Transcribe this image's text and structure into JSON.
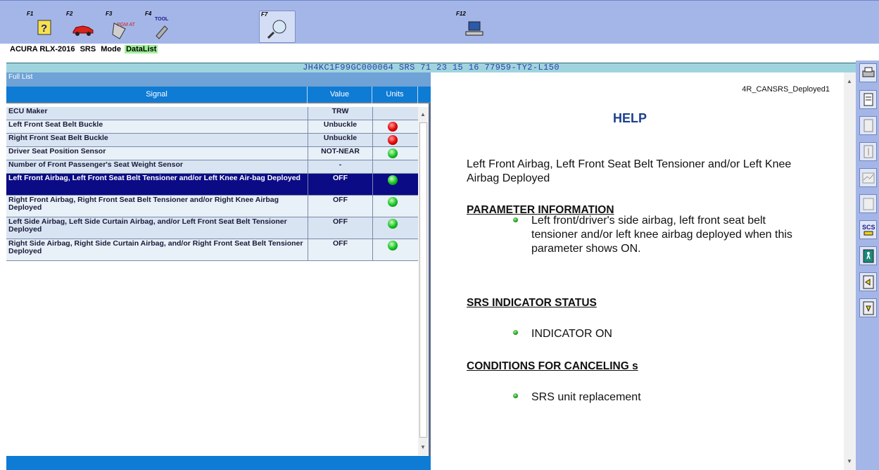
{
  "toolbar": {
    "keys": [
      {
        "label": "F1",
        "icon": "help-icon"
      },
      {
        "label": "F2",
        "icon": "car-icon"
      },
      {
        "label": "F3",
        "icon": "pgm-at-icon"
      },
      {
        "label": "F4",
        "icon": "tool-icon"
      },
      {
        "label": "F7",
        "icon": "search-globe-icon"
      },
      {
        "label": "F12",
        "icon": "computer-icon"
      }
    ],
    "tool_text": "TOOL",
    "pgm_text": "PGM AT"
  },
  "breadcrumb": {
    "vehicle": "ACURA RLX-2016",
    "system": "SRS",
    "mode_label": "Mode",
    "mode_value": "DataList"
  },
  "vin_bar": "JH4KC1F99GC000064  SRS  71 23 15 16  77959-TY2-L150",
  "list": {
    "title": "Full List",
    "headers": {
      "signal": "Signal",
      "value": "Value",
      "units": "Units"
    },
    "rows": [
      {
        "signal": "ECU Maker",
        "value": "TRW",
        "status": ""
      },
      {
        "signal": "Left Front Seat Belt Buckle",
        "value": "Unbuckle",
        "status": "red"
      },
      {
        "signal": "Right Front Seat Belt Buckle",
        "value": "Unbuckle",
        "status": "red"
      },
      {
        "signal": "Driver Seat Position Sensor",
        "value": "NOT-NEAR",
        "status": "green"
      },
      {
        "signal": "Number of Front Passenger's Seat Weight Sensor",
        "value": "-",
        "status": ""
      },
      {
        "signal": "Left Front Airbag, Left Front Seat Belt Tensioner and/or Left Knee Air-bag Deployed",
        "value": "OFF",
        "status": "green"
      },
      {
        "signal": "Right Front Airbag, Right Front Seat Belt Tensioner and/or Right Knee Airbag Deployed",
        "value": "OFF",
        "status": "green"
      },
      {
        "signal": "Left Side Airbag, Left Side Curtain Airbag, and/or Left Front Seat Belt Tensioner Deployed",
        "value": "OFF",
        "status": "green"
      },
      {
        "signal": "Right Side Airbag, Right Side Curtain Airbag, and/or Right Front Seat Belt Tensioner Deployed",
        "value": "OFF",
        "status": "green"
      }
    ],
    "selected_row": 5
  },
  "help": {
    "doc_id": "4R_CANSRS_Deployed1",
    "title": "HELP",
    "subject": "Left Front Airbag, Left Front Seat Belt Tensioner and/or Left Knee Airbag Deployed",
    "sections": [
      {
        "heading": "PARAMETER INFORMATION",
        "bullet": "Left front/driver's side airbag, left front seat belt tensioner and/or left knee airbag deployed when this parameter shows ON."
      },
      {
        "heading": "SRS INDICATOR STATUS",
        "bullet": "INDICATOR ON"
      },
      {
        "heading": "CONDITIONS FOR CANCELING s",
        "bullet": "SRS unit replacement"
      }
    ]
  },
  "side_toolbar": {
    "buttons": [
      "printer-icon",
      "report-icon",
      "page-icon",
      "list-icon",
      "graph-icon",
      "snapshot-icon",
      "scs-icon",
      "exit-icon",
      "sort-icon",
      "download-icon"
    ],
    "scs_text": "SCS"
  },
  "colors": {
    "toolbar_bg": "#a4b6e8",
    "header_blue": "#0e7bd4",
    "selected_row": "#0b0b85",
    "help_title": "#1b3f8f"
  }
}
